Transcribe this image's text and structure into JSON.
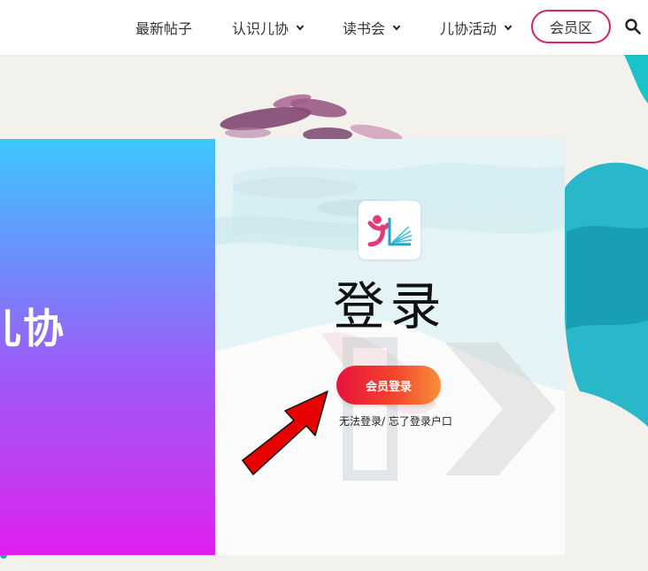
{
  "nav": {
    "items": [
      {
        "label": "最新帖子"
      },
      {
        "label": "认识儿协"
      },
      {
        "label": "读书会"
      },
      {
        "label": "儿协活动"
      }
    ],
    "member_button": "会员区",
    "search_icon": "search-icon"
  },
  "hero": {
    "title": "儿协"
  },
  "login_card": {
    "title": "登录",
    "button_label": "会员登录",
    "forgot_link": "无法登录/ 忘了登录户口"
  },
  "colors": {
    "accent_pink": "#d6226f",
    "button_gradient_start": "#e8123e",
    "button_gradient_end": "#f8903a",
    "panel_top": "#3ec7fd",
    "panel_bottom": "#e01ef0",
    "arrow_red": "#e60000"
  }
}
